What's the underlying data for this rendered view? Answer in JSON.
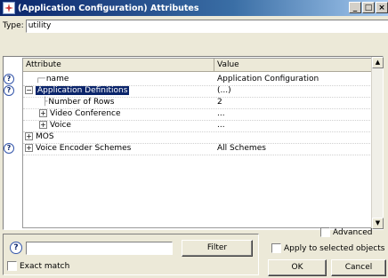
{
  "window": {
    "title": "(Application Configuration) Attributes",
    "minimize": "_",
    "maximize": "□",
    "close": "×"
  },
  "type_row": {
    "label": "Type:",
    "value": "utility"
  },
  "grid": {
    "columns": [
      "Attribute",
      "Value"
    ],
    "rows": [
      {
        "help": true,
        "expander": "",
        "prefix": "┌─",
        "attribute": "name",
        "value": "Application Configuration",
        "selected": false
      },
      {
        "help": true,
        "expander": "−",
        "prefix": "",
        "attribute": "Application Definitions",
        "value": "(...)",
        "selected": true
      },
      {
        "help": false,
        "expander": "",
        "prefix": "├",
        "attribute": "Number of Rows",
        "value": "2",
        "selected": false
      },
      {
        "help": false,
        "expander": "+",
        "prefix": "",
        "attribute": "Video Conference",
        "value": "...",
        "selected": false
      },
      {
        "help": false,
        "expander": "+",
        "prefix": "",
        "attribute": "Voice",
        "value": "...",
        "selected": false
      },
      {
        "help": false,
        "expander": "+",
        "prefix": "",
        "attribute": "MOS",
        "value": "",
        "selected": false
      },
      {
        "help": true,
        "expander": "+",
        "prefix": "",
        "attribute": "Voice Encoder Schemes",
        "value": "All Schemes",
        "selected": false
      }
    ]
  },
  "filter": {
    "help_glyph": "?",
    "value": "",
    "button": "Filter",
    "exact_match": "Exact match"
  },
  "options": {
    "advanced": "Advanced",
    "apply_selected": "Apply to selected objects",
    "ok": "OK",
    "cancel": "Cancel"
  },
  "colors": {
    "selection": "#0a246a",
    "titlebar": "#0a246a",
    "dialog_bg": "#ece9d8"
  }
}
